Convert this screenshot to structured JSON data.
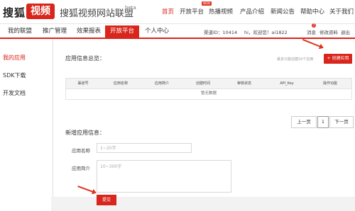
{
  "header": {
    "logo_text": "搜狐",
    "logo_badge": "视频",
    "site_title": "搜狐视频网站联盟",
    "beta": "beta",
    "nav": [
      "首页",
      "开放平台",
      "热播视频",
      "产品介绍",
      "新闻公告",
      "帮助中心",
      "关于我们"
    ],
    "new_badge": "NEW"
  },
  "tabs": [
    "我的联盟",
    "推广管理",
    "效果报表",
    "开放平台",
    "个人中心"
  ],
  "userbar": {
    "channel": "渠道ID：10414",
    "greeting": "hi，欢迎您！ai1822",
    "messages": "消息",
    "msg_count": "7",
    "change_password": "修改资料",
    "logout": "退出"
  },
  "sidebar": {
    "items": [
      "我的应用",
      "SDK下载",
      "开发文档"
    ]
  },
  "main": {
    "overview_title": "应用信息总览：",
    "limit_hint": "最多只能创建10个应用",
    "create_button": "+ 创建应用",
    "table_headers": [
      "渠道号",
      "应用名称",
      "应用简介",
      "创建时间",
      "审核状态",
      "API_Key",
      "操作功能"
    ],
    "no_data": "暂无数据",
    "pagination": {
      "prev": "上一页",
      "page": "1",
      "next": "下一页"
    },
    "form_title": "新增应用信息：",
    "name_label": "应用名称",
    "name_placeholder": "1~20字",
    "desc_label": "应用简介",
    "desc_placeholder": "10~300字",
    "submit": "提交"
  },
  "colors": {
    "accent": "#d8261c"
  }
}
